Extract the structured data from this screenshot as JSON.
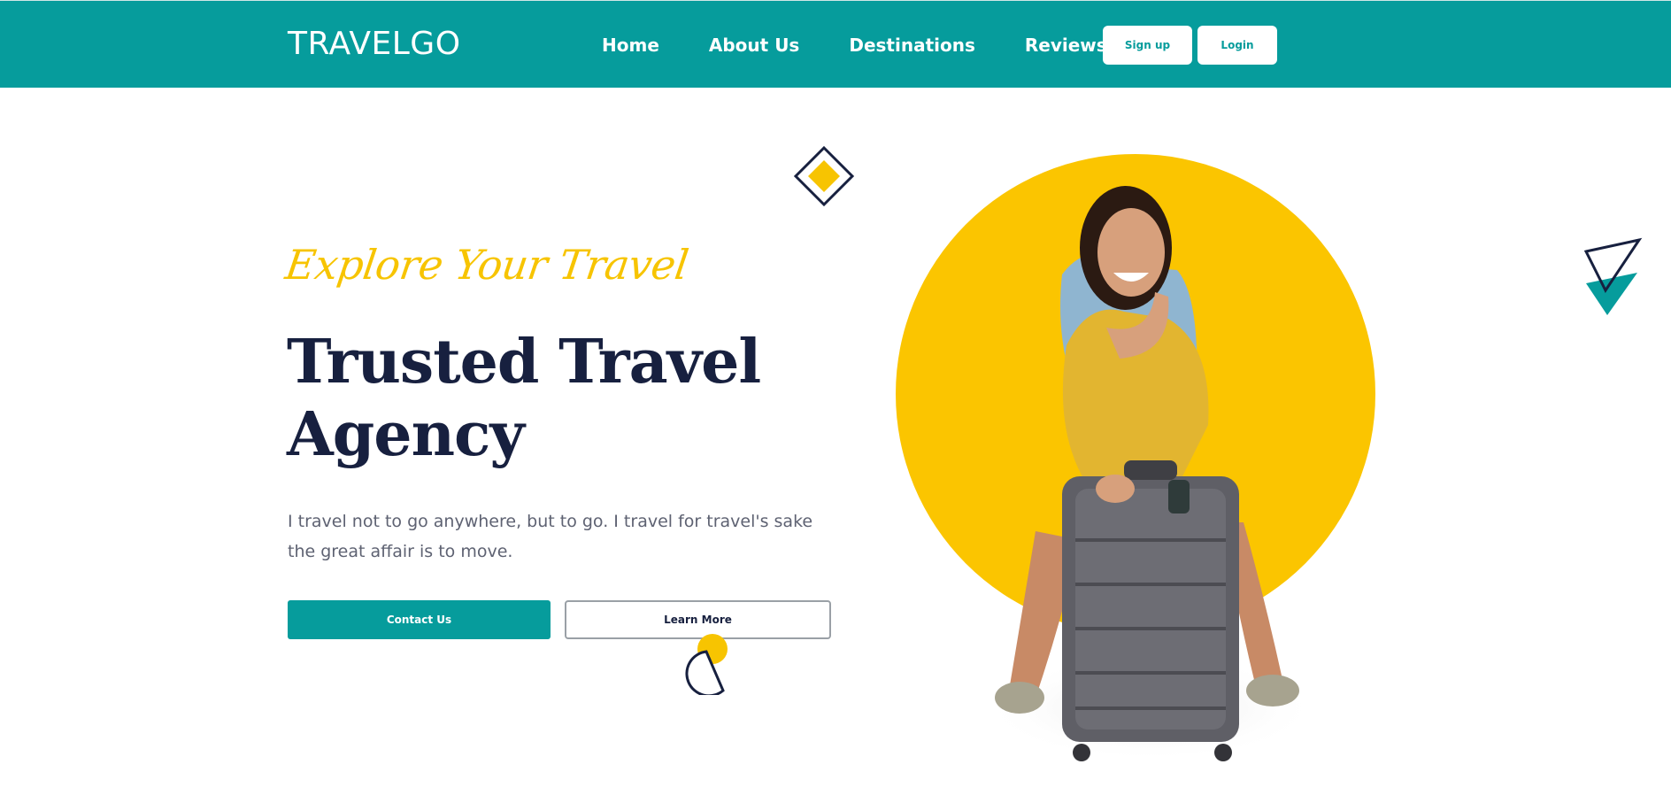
{
  "brand": {
    "logo": "TRAVELGO"
  },
  "nav": {
    "links": [
      {
        "label": "Home"
      },
      {
        "label": "About Us"
      },
      {
        "label": "Destinations"
      },
      {
        "label": "Reviews"
      }
    ],
    "signup_label": "Sign up",
    "login_label": "Login"
  },
  "hero": {
    "tagline": "Explore Your Travel",
    "headline": "Trusted Travel Agency",
    "description": "I travel not to go anywhere, but to go. I travel for travel's sake the great affair is to move.",
    "contact_label": "Contact Us",
    "learn_label": "Learn More"
  },
  "colors": {
    "accent": "#069c9c",
    "yellow": "#f7c401",
    "navy": "#17203f",
    "body_text": "#5e6272"
  },
  "icons": [
    "diamond-shape",
    "half-circle-shape",
    "triangle-shape"
  ]
}
